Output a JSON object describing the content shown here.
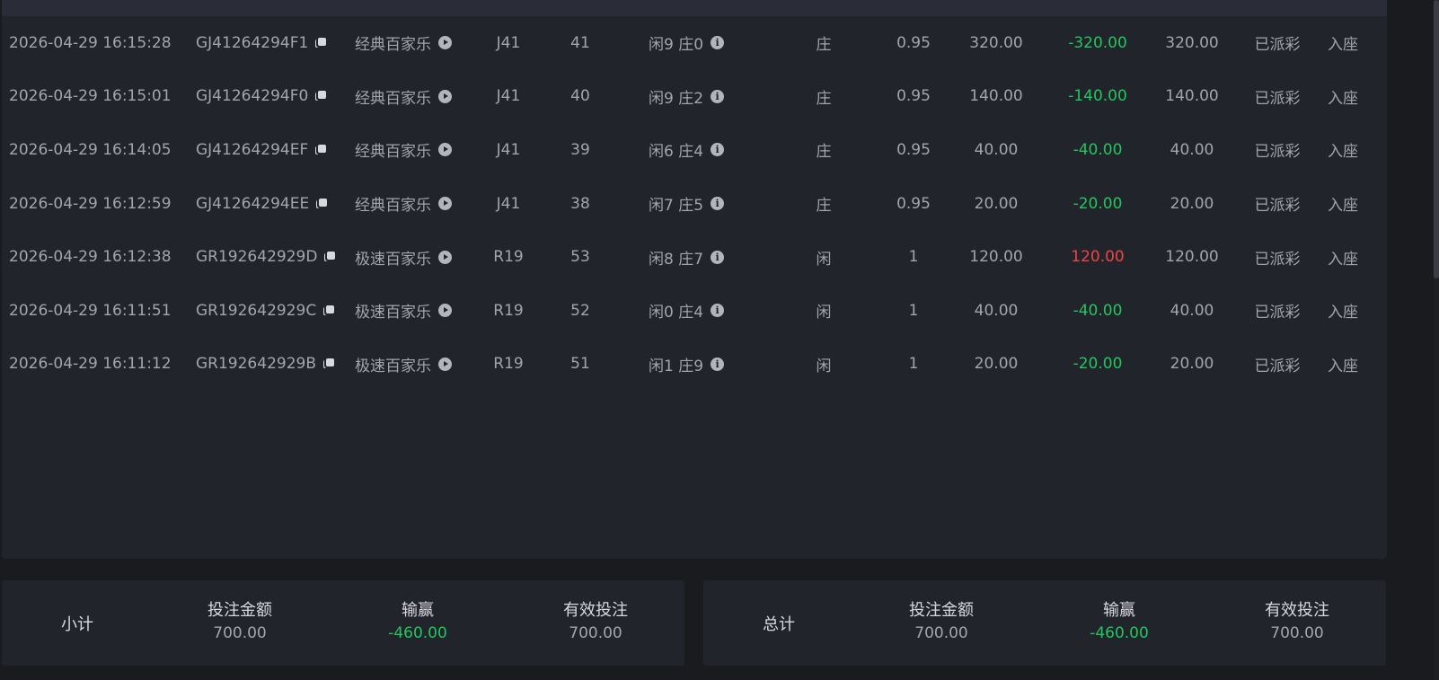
{
  "rows": [
    {
      "time": "2026-04-29 16:15:28",
      "id": "GJ41264294F1",
      "game": "经典百家乐",
      "table": "J41",
      "round": "41",
      "result": "闲9 庄0",
      "bet": "庄",
      "odds": "0.95",
      "amount": "320.00",
      "win": "-320.00",
      "valid": "320.00",
      "status": "已派彩",
      "action": "入座"
    },
    {
      "time": "2026-04-29 16:15:01",
      "id": "GJ41264294F0",
      "game": "经典百家乐",
      "table": "J41",
      "round": "40",
      "result": "闲9 庄2",
      "bet": "庄",
      "odds": "0.95",
      "amount": "140.00",
      "win": "-140.00",
      "valid": "140.00",
      "status": "已派彩",
      "action": "入座"
    },
    {
      "time": "2026-04-29 16:14:05",
      "id": "GJ41264294EF",
      "game": "经典百家乐",
      "table": "J41",
      "round": "39",
      "result": "闲6 庄4",
      "bet": "庄",
      "odds": "0.95",
      "amount": "40.00",
      "win": "-40.00",
      "valid": "40.00",
      "status": "已派彩",
      "action": "入座"
    },
    {
      "time": "2026-04-29 16:12:59",
      "id": "GJ41264294EE",
      "game": "经典百家乐",
      "table": "J41",
      "round": "38",
      "result": "闲7 庄5",
      "bet": "庄",
      "odds": "0.95",
      "amount": "20.00",
      "win": "-20.00",
      "valid": "20.00",
      "status": "已派彩",
      "action": "入座"
    },
    {
      "time": "2026-04-29 16:12:38",
      "id": "GR192642929D",
      "game": "极速百家乐",
      "table": "R19",
      "round": "53",
      "result": "闲8 庄7",
      "bet": "闲",
      "odds": "1",
      "amount": "120.00",
      "win": "120.00",
      "valid": "120.00",
      "status": "已派彩",
      "action": "入座"
    },
    {
      "time": "2026-04-29 16:11:51",
      "id": "GR192642929C",
      "game": "极速百家乐",
      "table": "R19",
      "round": "52",
      "result": "闲0 庄4",
      "bet": "闲",
      "odds": "1",
      "amount": "40.00",
      "win": "-40.00",
      "valid": "40.00",
      "status": "已派彩",
      "action": "入座"
    },
    {
      "time": "2026-04-29 16:11:12",
      "id": "GR192642929B",
      "game": "极速百家乐",
      "table": "R19",
      "round": "51",
      "result": "闲1 庄9",
      "bet": "闲",
      "odds": "1",
      "amount": "20.00",
      "win": "-20.00",
      "valid": "20.00",
      "status": "已派彩",
      "action": "入座"
    }
  ],
  "subtotal": {
    "label": "小计",
    "bet_label": "投注金额",
    "bet_value": "700.00",
    "win_label": "输赢",
    "win_value": "-460.00",
    "valid_label": "有效投注",
    "valid_value": "700.00"
  },
  "total": {
    "label": "总计",
    "bet_label": "投注金额",
    "bet_value": "700.00",
    "win_label": "输赢",
    "win_value": "-460.00",
    "valid_label": "有效投注",
    "valid_value": "700.00"
  },
  "colors": {
    "win_negative": "#22c55e",
    "win_positive": "#ef4444"
  },
  "icons": {
    "id_copy": "copy-icon",
    "game_play": "play-circle-icon",
    "result_info": "info-circle-icon"
  }
}
